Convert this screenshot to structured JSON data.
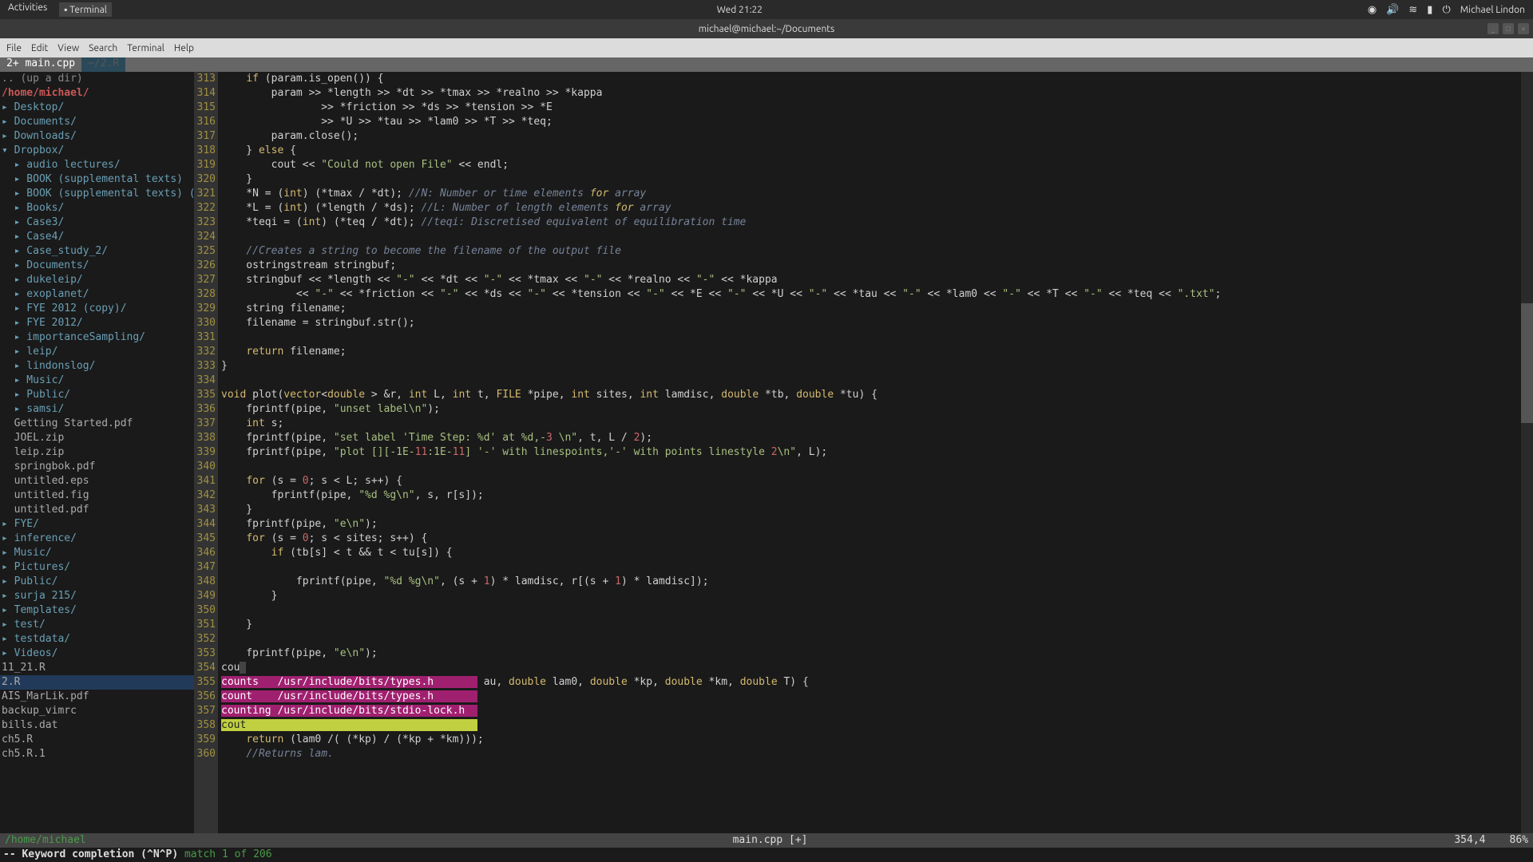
{
  "topbar": {
    "activities": "Activities",
    "terminal": "Terminal",
    "clock": "Wed 21:22",
    "user": "Michael Lindon"
  },
  "window": {
    "title": "michael@michael:~/Documents"
  },
  "menu": {
    "file": "File",
    "edit": "Edit",
    "view": "View",
    "search": "Search",
    "terminal": "Terminal",
    "help": "Help"
  },
  "tabs": {
    "t1": "2+ main.cpp",
    "t2": "~/2.R"
  },
  "sidebar": {
    "updir": ".. (up a dir)",
    "path": "/home/michael/",
    "items": [
      {
        "t": "dir",
        "d": 1,
        "label": "Desktop/",
        "tri": "▸"
      },
      {
        "t": "dir",
        "d": 1,
        "label": "Documents/",
        "tri": "▸"
      },
      {
        "t": "dir",
        "d": 1,
        "label": "Downloads/",
        "tri": "▸"
      },
      {
        "t": "dir",
        "d": 1,
        "label": "Dropbox/",
        "tri": "▾"
      },
      {
        "t": "dir",
        "d": 2,
        "label": "audio lectures/",
        "tri": "▸"
      },
      {
        "t": "dir",
        "d": 2,
        "label": "BOOK (supplemental texts)",
        "tri": "▸"
      },
      {
        "t": "dir",
        "d": 2,
        "label": "BOOK (supplemental texts) (",
        "tri": "▸"
      },
      {
        "t": "dir",
        "d": 2,
        "label": "Books/",
        "tri": "▸"
      },
      {
        "t": "dir",
        "d": 2,
        "label": "Case3/",
        "tri": "▸"
      },
      {
        "t": "dir",
        "d": 2,
        "label": "Case4/",
        "tri": "▸"
      },
      {
        "t": "dir",
        "d": 2,
        "label": "Case_study_2/",
        "tri": "▸"
      },
      {
        "t": "dir",
        "d": 2,
        "label": "Documents/",
        "tri": "▸"
      },
      {
        "t": "dir",
        "d": 2,
        "label": "dukeleip/",
        "tri": "▸"
      },
      {
        "t": "dir",
        "d": 2,
        "label": "exoplanet/",
        "tri": "▸"
      },
      {
        "t": "dir",
        "d": 2,
        "label": "FYE 2012 (copy)/",
        "tri": "▸"
      },
      {
        "t": "dir",
        "d": 2,
        "label": "FYE 2012/",
        "tri": "▸"
      },
      {
        "t": "dir",
        "d": 2,
        "label": "importanceSampling/",
        "tri": "▸"
      },
      {
        "t": "dir",
        "d": 2,
        "label": "leip/",
        "tri": "▸"
      },
      {
        "t": "dir",
        "d": 2,
        "label": "lindonslog/",
        "tri": "▸"
      },
      {
        "t": "dir",
        "d": 2,
        "label": "Music/",
        "tri": "▸"
      },
      {
        "t": "dir",
        "d": 2,
        "label": "Public/",
        "tri": "▸"
      },
      {
        "t": "dir",
        "d": 2,
        "label": "samsi/",
        "tri": "▸"
      },
      {
        "t": "file",
        "d": 2,
        "label": "Getting Started.pdf"
      },
      {
        "t": "file",
        "d": 2,
        "label": "JOEL.zip"
      },
      {
        "t": "file",
        "d": 2,
        "label": "leip.zip"
      },
      {
        "t": "file",
        "d": 2,
        "label": "springbok.pdf"
      },
      {
        "t": "file",
        "d": 2,
        "label": "untitled.eps"
      },
      {
        "t": "file",
        "d": 2,
        "label": "untitled.fig"
      },
      {
        "t": "file",
        "d": 2,
        "label": "untitled.pdf"
      },
      {
        "t": "dir",
        "d": 1,
        "label": "FYE/",
        "tri": "▸"
      },
      {
        "t": "dir",
        "d": 1,
        "label": "inference/",
        "tri": "▸"
      },
      {
        "t": "dir",
        "d": 1,
        "label": "Music/",
        "tri": "▸"
      },
      {
        "t": "dir",
        "d": 1,
        "label": "Pictures/",
        "tri": "▸"
      },
      {
        "t": "dir",
        "d": 1,
        "label": "Public/",
        "tri": "▸"
      },
      {
        "t": "dir",
        "d": 1,
        "label": "surja 215/",
        "tri": "▸"
      },
      {
        "t": "dir",
        "d": 1,
        "label": "Templates/",
        "tri": "▸"
      },
      {
        "t": "dir",
        "d": 1,
        "label": "test/",
        "tri": "▸"
      },
      {
        "t": "dir",
        "d": 1,
        "label": "testdata/",
        "tri": "▸"
      },
      {
        "t": "dir",
        "d": 1,
        "label": "Videos/",
        "tri": "▸"
      },
      {
        "t": "file",
        "d": 1,
        "label": "11_21.R"
      },
      {
        "t": "file",
        "d": 1,
        "label": "2.R",
        "sel": true
      },
      {
        "t": "file",
        "d": 1,
        "label": "AIS_MarLik.pdf"
      },
      {
        "t": "file",
        "d": 1,
        "label": "backup_vimrc"
      },
      {
        "t": "file",
        "d": 1,
        "label": "bills.dat"
      },
      {
        "t": "file",
        "d": 1,
        "label": "ch5.R"
      },
      {
        "t": "file",
        "d": 1,
        "label": "ch5.R.1"
      }
    ]
  },
  "code": {
    "start": 313,
    "lines": [
      "    if (param.is_open()) {",
      "        param >> *length >> *dt >> *tmax >> *realno >> *kappa",
      "                >> *friction >> *ds >> *tension >> *E",
      "                >> *U >> *tau >> *lam0 >> *T >> *teq;",
      "        param.close();",
      "    } else {",
      "        cout << \"Could not open File\" << endl;",
      "    }",
      "    *N = (int) (*tmax / *dt); //N: Number or time elements for array",
      "    *L = (int) (*length / *ds); //L: Number of length elements for array",
      "    *teqi = (int) (*teq / *dt); //teqi: Discretised equivalent of equilibration time",
      "",
      "    //Creates a string to become the filename of the output file",
      "    ostringstream stringbuf;",
      "    stringbuf << *length << \"-\" << *dt << \"-\" << *tmax << \"-\" << *realno << \"-\" << *kappa",
      "            << \"-\" << *friction << \"-\" << *ds << \"-\" << *tension << \"-\" << *E << \"-\" << *U << \"-\" << *tau << \"-\" << *lam0 << \"-\" << *T << \"-\" << *teq << \".txt\";",
      "    string filename;",
      "    filename = stringbuf.str();",
      "",
      "    return filename;",
      "}",
      "",
      "void plot(vector<double > &r, int L, int t, FILE *pipe, int sites, int lamdisc, double *tb, double *tu) {",
      "    fprintf(pipe, \"unset label\\n\");",
      "    int s;",
      "    fprintf(pipe, \"set label 'Time Step: %d' at %d,-3 \\n\", t, L / 2);",
      "    fprintf(pipe, \"plot [][-1E-11:1E-11] '-' with linespoints,'-' with points linestyle 2\\n\", L);",
      "",
      "    for (s = 0; s < L; s++) {",
      "        fprintf(pipe, \"%d %g\\n\", s, r[s]);",
      "    }",
      "    fprintf(pipe, \"e\\n\");",
      "    for (s = 0; s < sites; s++) {",
      "        if (tb[s] < t && t < tu[s]) {",
      "",
      "            fprintf(pipe, \"%d %g\\n\", (s + 1) * lamdisc, r[(s + 1) * lamdisc]);",
      "        }",
      "",
      "    }",
      "",
      "    fprintf(pipe, \"e\\n\");",
      "cou",
      "counts   /usr/include/bits/types.h  au, double lam0, double *kp, double *km, double T) {",
      "count    /usr/include/bits/types.h",
      "counting /usr/include/bits/stdio-lock.h",
      "cout",
      "    return (lam0 /( (*kp) / (*kp + *km)));",
      "    //Returns lam."
    ],
    "completion": {
      "items": [
        {
          "w": "counts",
          "p": "/usr/include/bits/types.h"
        },
        {
          "w": "count",
          "p": "/usr/include/bits/types.h"
        },
        {
          "w": "counting",
          "p": "/usr/include/bits/stdio-lock.h"
        },
        {
          "w": "cout",
          "p": "",
          "sel": true
        }
      ]
    }
  },
  "status": {
    "left_path": "/home/michael",
    "filename": "main.cpp  [+]",
    "pos": "354,4",
    "pct": "86%",
    "mode": "-- Keyword completion (^N^P) ",
    "match": "match 1 of 206"
  }
}
